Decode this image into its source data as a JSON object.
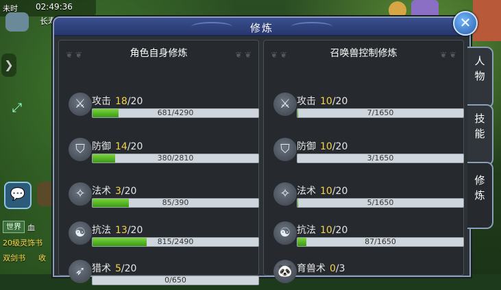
{
  "hud": {
    "time_label": "未时",
    "clock": "02:49:36",
    "location": "长寿村"
  },
  "window": {
    "title": "修炼",
    "close_label": "✕",
    "left_panel": {
      "title": "角色自身修炼",
      "skills": [
        {
          "name": "攻击",
          "level": "18",
          "max": "/20",
          "progress_text": "681/4290",
          "progress": 0.159,
          "icon": "sword-icon",
          "glyph": "⚔"
        },
        {
          "name": "防御",
          "level": "14",
          "max": "/20",
          "progress_text": "380/2810",
          "progress": 0.135,
          "icon": "shield-icon",
          "glyph": "⛉"
        },
        {
          "name": "法术",
          "level": "3",
          "max": "/20",
          "progress_text": "85/390",
          "progress": 0.218,
          "icon": "magic-icon",
          "glyph": "✧"
        },
        {
          "name": "抗法",
          "level": "13",
          "max": "/20",
          "progress_text": "815/2490",
          "progress": 0.327,
          "icon": "yin-yang-icon",
          "glyph": "☯"
        },
        {
          "name": "猎术",
          "level": "5",
          "max": "/20",
          "progress_text": "0/650",
          "progress": 0.0,
          "icon": "bow-icon",
          "glyph": "➶"
        }
      ]
    },
    "right_panel": {
      "title": "召唤兽控制修炼",
      "skills": [
        {
          "name": "攻击",
          "level": "10",
          "max": "/20",
          "progress_text": "7/1650",
          "progress": 0.004,
          "icon": "sword-icon",
          "glyph": "⚔"
        },
        {
          "name": "防御",
          "level": "10",
          "max": "/20",
          "progress_text": "3/1650",
          "progress": 0.002,
          "icon": "shield-icon",
          "glyph": "⛉"
        },
        {
          "name": "法术",
          "level": "10",
          "max": "/20",
          "progress_text": "5/1650",
          "progress": 0.003,
          "icon": "magic-icon",
          "glyph": "✧"
        },
        {
          "name": "抗法",
          "level": "10",
          "max": "/20",
          "progress_text": "87/1650",
          "progress": 0.053,
          "icon": "yin-yang-icon",
          "glyph": "☯"
        },
        {
          "name": "育兽术",
          "level": "0",
          "max": "/3",
          "progress_text": "",
          "progress": null,
          "icon": "panda-icon",
          "glyph": "🐼"
        }
      ]
    }
  },
  "tabs": [
    {
      "label": "人\n物",
      "active": false
    },
    {
      "label": "技\n能",
      "active": false
    },
    {
      "label": "修\n炼",
      "active": true
    }
  ],
  "chat": {
    "channel": "世界",
    "lines": [
      "血",
      "20级灵饰书",
      "双剑书",
      "收"
    ]
  },
  "colors": {
    "accent": "#f3d44b",
    "bar_fill": "#5bbf28",
    "title_bar": "#2f437f"
  }
}
